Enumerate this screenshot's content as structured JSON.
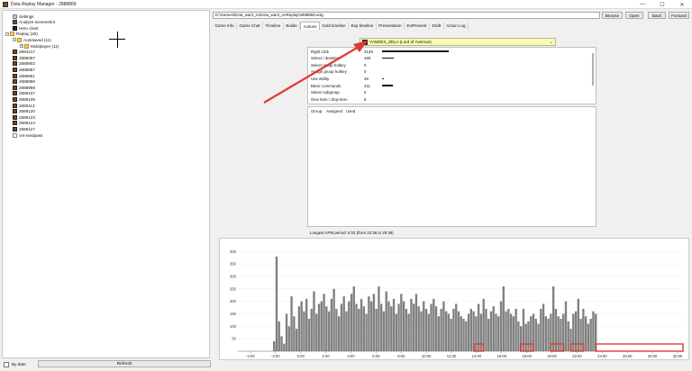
{
  "window": {
    "title": "Dota Replay Manager - 2888869",
    "controls": {
      "minimize": "—",
      "maximize": "☐",
      "close": "✕"
    }
  },
  "tree": {
    "items": [
      {
        "label": "Settings",
        "icon": "settings-icon",
        "depth": 1,
        "expander": ""
      },
      {
        "label": "Analyze screenshot",
        "icon": "camera-icon",
        "depth": 1,
        "expander": ""
      },
      {
        "label": "Hero chart",
        "icon": "chart-icon",
        "depth": 1,
        "expander": ""
      },
      {
        "label": "Replay (26)",
        "icon": "folder-icon",
        "depth": 0,
        "expander": "−"
      },
      {
        "label": "Autosaved (11)",
        "icon": "folder-icon",
        "depth": 1,
        "expander": "−"
      },
      {
        "label": "Multiplayer (11)",
        "icon": "folder-icon",
        "depth": 2,
        "expander": "+"
      },
      {
        "label": "2884217",
        "icon": "replay-icon",
        "depth": 1,
        "expander": ""
      },
      {
        "label": "2885097",
        "icon": "replay-icon",
        "depth": 1,
        "expander": ""
      },
      {
        "label": "2888903",
        "icon": "replay-icon",
        "depth": 1,
        "expander": ""
      },
      {
        "label": "2888957",
        "icon": "replay-icon",
        "depth": 1,
        "expander": ""
      },
      {
        "label": "2888961",
        "icon": "replay-icon",
        "depth": 1,
        "expander": ""
      },
      {
        "label": "2888996",
        "icon": "replay-icon",
        "depth": 1,
        "expander": ""
      },
      {
        "label": "2888999",
        "icon": "replay-icon",
        "depth": 1,
        "expander": ""
      },
      {
        "label": "2889107",
        "icon": "replay-icon",
        "depth": 1,
        "expander": ""
      },
      {
        "label": "2889109",
        "icon": "replay-icon",
        "depth": 1,
        "expander": ""
      },
      {
        "label": "2889113",
        "icon": "replay-icon",
        "depth": 1,
        "expander": ""
      },
      {
        "label": "2889120",
        "icon": "replay-icon",
        "depth": 1,
        "expander": ""
      },
      {
        "label": "2889123",
        "icon": "replay-icon",
        "depth": 1,
        "expander": ""
      },
      {
        "label": "2889124",
        "icon": "replay-icon",
        "depth": 1,
        "expander": ""
      },
      {
        "label": "2889127",
        "icon": "replay-icon",
        "depth": 1,
        "expander": ""
      },
      {
        "label": "cet-medpass",
        "icon": "file-icon",
        "depth": 1,
        "expander": ""
      }
    ]
  },
  "bottom": {
    "by_date": "By date",
    "refresh": "Refresh"
  },
  "toolbar": {
    "path": "D:\\Games\\Dota_war3_ru\\Dota_war3_ru\\Replay\\2888869.w3g",
    "browse": "Browse",
    "open": "Open",
    "back": "Back",
    "forward": "Forward"
  },
  "tabs": [
    {
      "label": "Game Info",
      "active": false
    },
    {
      "label": "Game Chat",
      "active": false
    },
    {
      "label": "Timeline",
      "active": false
    },
    {
      "label": "Builds",
      "active": false
    },
    {
      "label": "Actions",
      "active": true
    },
    {
      "label": "Gold timeline",
      "active": false
    },
    {
      "label": "Exp timeline",
      "active": false
    },
    {
      "label": "Presentation",
      "active": false
    },
    {
      "label": "ExtPresent",
      "active": false
    },
    {
      "label": "Draft",
      "active": false
    },
    {
      "label": "Action Log",
      "active": false
    }
  ],
  "player_select": "YANDEX_ZELA (Lord of Avernus)",
  "stats": [
    {
      "label": "Right click",
      "value": "2129",
      "level": 0.57
    },
    {
      "label": "Select / deselect",
      "value": "460",
      "level": 0.1
    },
    {
      "label": "Select group hotkey",
      "value": "0",
      "level": 0
    },
    {
      "label": "Assign group hotkey",
      "value": "0",
      "level": 0
    },
    {
      "label": "Use ability",
      "value": "46",
      "level": 0.01
    },
    {
      "label": "Basic commands",
      "value": "411",
      "level": 0.09
    },
    {
      "label": "Select subgroup",
      "value": "0",
      "level": 0
    },
    {
      "label": "Give item / drop item",
      "value": "6",
      "level": 0
    }
  ],
  "group_table": {
    "columns": [
      "Group",
      "Assigned",
      "Used"
    ]
  },
  "apm_text": "Longest APM period: 6:02 (from 23:36 to 29:38)",
  "chart_data": {
    "type": "bar",
    "title": "",
    "xlabel": "",
    "ylabel": "",
    "x_ticks": [
      "-4:00",
      "-2:00",
      "0:00",
      "2:00",
      "4:00",
      "6:00",
      "8:00",
      "10:00",
      "12:00",
      "14:00",
      "16:00",
      "18:00",
      "20:00",
      "22:00",
      "24:00",
      "26:00",
      "28:00",
      "30:00"
    ],
    "y_ticks": [
      "50",
      "100",
      "150",
      "200",
      "250",
      "300",
      "350",
      "400"
    ],
    "xlim": [
      -5,
      30.5
    ],
    "ylim": [
      0,
      430
    ],
    "x_start": -2.2,
    "x_end": 23.6,
    "bar_color": "#808080",
    "highlight_color": "#e03a32",
    "highlights": [
      {
        "x0": 13.8,
        "x1": 14.6
      },
      {
        "x0": 17.5,
        "x1": 18.6
      },
      {
        "x0": 19.9,
        "x1": 21.0
      },
      {
        "x0": 21.5,
        "x1": 22.6
      },
      {
        "x0": 23.5,
        "x1": 30.5
      }
    ],
    "series": [
      {
        "values": [
          40,
          380,
          120,
          60,
          30,
          150,
          100,
          220,
          140,
          90,
          180,
          200,
          160,
          210,
          130,
          170,
          240,
          150,
          190,
          200,
          230,
          180,
          160,
          210,
          250,
          170,
          140,
          190,
          220,
          160,
          200,
          230,
          260,
          190,
          170,
          210,
          180,
          150,
          220,
          200,
          230,
          170,
          260,
          190,
          160,
          240,
          200,
          180,
          210,
          150,
          190,
          230,
          200,
          170,
          150,
          210,
          190,
          230,
          180,
          160,
          200,
          170,
          150,
          190,
          210,
          180,
          140,
          170,
          200,
          160,
          150,
          130,
          170,
          190,
          160,
          140,
          130,
          120,
          150,
          170,
          160,
          140,
          190,
          150,
          210,
          170,
          130,
          160,
          180,
          150,
          140,
          200,
          260,
          160,
          170,
          150,
          140,
          170,
          120,
          100,
          170,
          110,
          120,
          140,
          150,
          130,
          110,
          170,
          190,
          140,
          130,
          150,
          260,
          170,
          140,
          130,
          150,
          200,
          120,
          90,
          150,
          160,
          210,
          130,
          170,
          140,
          110,
          130,
          160,
          150
        ]
      }
    ]
  },
  "annotation": {
    "arrow_color": "#e03a32"
  }
}
